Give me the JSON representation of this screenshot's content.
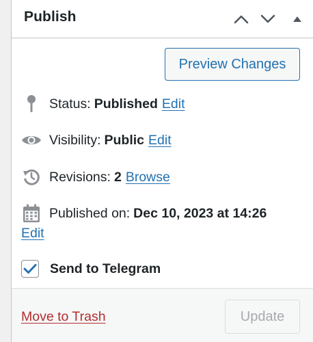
{
  "header": {
    "title": "Publish",
    "move_up_icon": "chevron-up-icon",
    "move_down_icon": "chevron-down-icon",
    "toggle_icon": "triangle-up-icon"
  },
  "actions": {
    "preview_label": "Preview Changes"
  },
  "status": {
    "icon": "pin-icon",
    "label": "Status:",
    "value": "Published",
    "link": "Edit"
  },
  "visibility": {
    "icon": "eye-icon",
    "label": "Visibility:",
    "value": "Public",
    "link": "Edit"
  },
  "revisions": {
    "icon": "history-icon",
    "label": "Revisions:",
    "value": "2",
    "link": "Browse"
  },
  "published_on": {
    "icon": "calendar-icon",
    "label": "Published on:",
    "value": "Dec 10, 2023 at 14:26",
    "link": "Edit"
  },
  "telegram": {
    "label": "Send to Telegram",
    "checked": true
  },
  "footer": {
    "trash_label": "Move to Trash",
    "update_label": "Update"
  },
  "colors": {
    "link": "#2271b1",
    "trash": "#b32d2e",
    "disabled_text": "#a7aaad",
    "icon_gray": "#8c8f94"
  }
}
